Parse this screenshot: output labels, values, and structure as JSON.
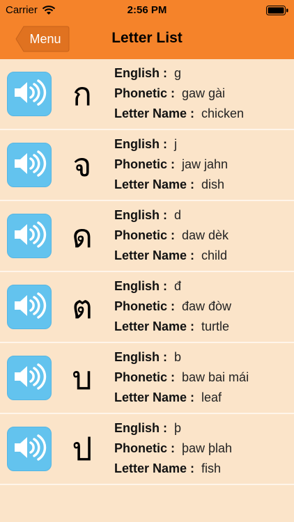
{
  "status_bar": {
    "carrier": "Carrier",
    "time": "2:56 PM"
  },
  "nav": {
    "back_label": "Menu",
    "title": "Letter List"
  },
  "labels": {
    "english": "English :",
    "phonetic": "Phonetic :",
    "letter_name": "Letter Name :"
  },
  "colors": {
    "header": "#f5832a",
    "background": "#fbe4c9",
    "speaker": "#63c3ee"
  },
  "letters": [
    {
      "thai": "ก",
      "english": "g",
      "phonetic": "gaw gài",
      "name": "chicken"
    },
    {
      "thai": "จ",
      "english": "j",
      "phonetic": "jaw jahn",
      "name": "dish"
    },
    {
      "thai": "ด",
      "english": "d",
      "phonetic": "daw dèk",
      "name": "child"
    },
    {
      "thai": "ต",
      "english": "đ",
      "phonetic": "đaw đòw",
      "name": "turtle"
    },
    {
      "thai": "บ",
      "english": "b",
      "phonetic": "baw bai mái",
      "name": "leaf"
    },
    {
      "thai": "ป",
      "english": "þ",
      "phonetic": "þaw þlah",
      "name": "fish"
    }
  ]
}
